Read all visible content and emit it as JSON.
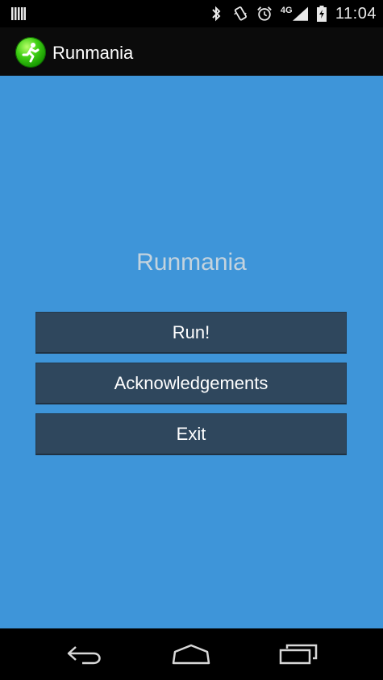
{
  "status_bar": {
    "time": "11:04",
    "network_label": "4G",
    "icons": [
      "notification-icon",
      "bluetooth-icon",
      "vibrate-icon",
      "alarm-icon",
      "signal-icon",
      "battery-icon"
    ]
  },
  "action_bar": {
    "title": "Runmania",
    "icon": "runner-app-icon"
  },
  "main": {
    "title": "Runmania",
    "buttons": {
      "run": "Run!",
      "acknowledgements": "Acknowledgements",
      "exit": "Exit"
    }
  },
  "nav_bar": {
    "icons": [
      "back-icon",
      "home-icon",
      "recent-apps-icon"
    ]
  },
  "colors": {
    "background": "#3e95d9",
    "button": "#2f475d",
    "title_text": "#c3d3de",
    "action_bar": "#0b0b0b"
  }
}
